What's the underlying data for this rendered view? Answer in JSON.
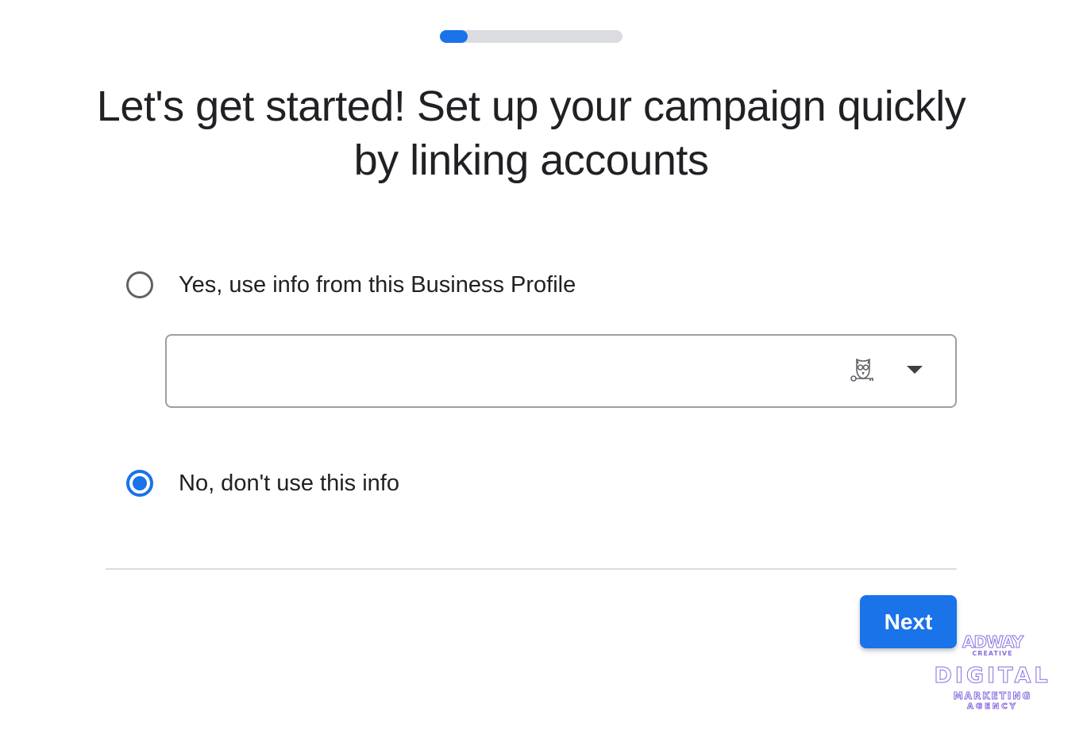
{
  "progress": {
    "value_percent": 15,
    "fill_color": "#1a73e8",
    "track_color": "#dadce0"
  },
  "header": {
    "title": "Let's get started! Set up your campaign quickly by linking accounts"
  },
  "options": [
    {
      "label": "Yes, use info from this Business Profile",
      "selected": false
    },
    {
      "label": "No, don't use this info",
      "selected": true
    }
  ],
  "dropdown": {
    "value": "",
    "icon": "owl-key-icon",
    "arrow": "chevron-down-icon"
  },
  "footer": {
    "next_label": "Next"
  },
  "watermark": {
    "brand": "ADWAY",
    "brand_sub": "CREATIVE",
    "line1": "DIGITAL",
    "line2": "MARKETING",
    "line3": "AGENCY"
  },
  "colors": {
    "accent": "#1a73e8",
    "text": "#202124",
    "border": "#9aa0a6"
  }
}
